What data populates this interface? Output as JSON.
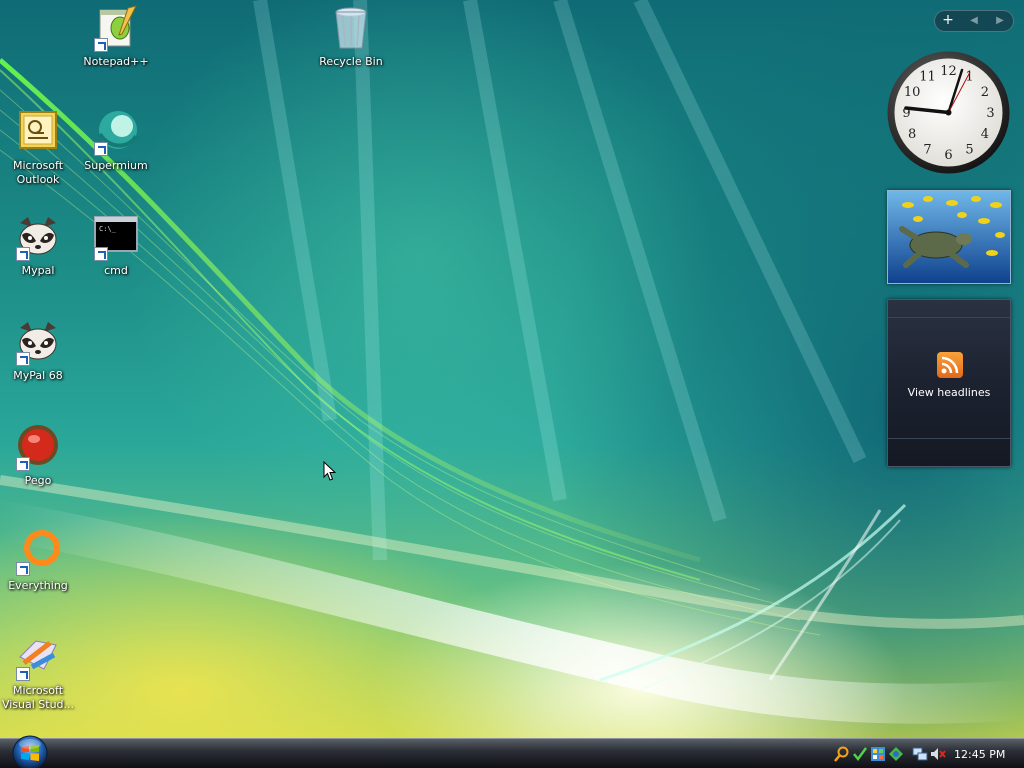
{
  "desktop": {
    "icons": [
      {
        "label": "Notepad++"
      },
      {
        "label": "Recycle Bin"
      },
      {
        "label": "Microsoft Outlook"
      },
      {
        "label": "Supermium"
      },
      {
        "label": "Mypal"
      },
      {
        "label": "cmd"
      },
      {
        "label": "MyPal 68"
      },
      {
        "label": "Pego"
      },
      {
        "label": "Everything"
      },
      {
        "label": "Microsoft Visual Stud..."
      }
    ]
  },
  "sidebar": {
    "add_label": "+",
    "prev_label": "◀",
    "next_label": "▶",
    "clock_numerals": [
      "12",
      "1",
      "2",
      "3",
      "4",
      "5",
      "6",
      "7",
      "8",
      "9",
      "10",
      "11"
    ],
    "feed_label": "View headlines"
  },
  "taskbar": {
    "clock": "12:45 PM"
  }
}
